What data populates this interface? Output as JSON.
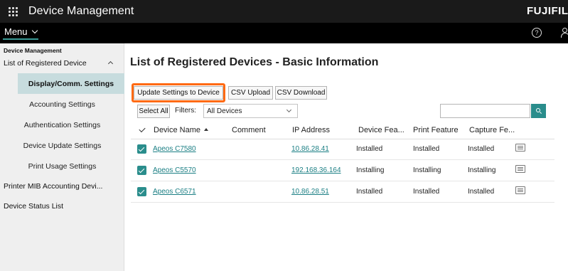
{
  "app": {
    "title": "Device Management",
    "brand": "FUJIFILM",
    "menu_label": "Menu",
    "help_symbol": "?"
  },
  "sidebar": {
    "header": "Device Management",
    "group": "List of Registered Device",
    "subitems": [
      {
        "label": "Display/Comm. Settings",
        "active": true
      },
      {
        "label": "Accounting Settings"
      },
      {
        "label": "Authentication Settings"
      },
      {
        "label": "Device Update Settings"
      },
      {
        "label": "Print Usage Settings"
      }
    ],
    "items": [
      {
        "label": "Printer MIB Accounting Devi..."
      },
      {
        "label": "Device Status List"
      }
    ]
  },
  "main": {
    "title": "List of Registered Devices - Basic Information",
    "toolbar": {
      "update_label": "Update Settings to Device",
      "csv_upload_label": "CSV Upload",
      "csv_download_label": "CSV Download",
      "select_all_label": "Select All",
      "filter_label": "Filters:",
      "filter_value": "All Devices"
    },
    "table": {
      "headers": {
        "device_name": "Device Name",
        "comment": "Comment",
        "ip": "IP Address",
        "device_feature": "Device Fea...",
        "print_feature": "Print Feature",
        "capture_feature": "Capture Fe..."
      },
      "rows": [
        {
          "name": "Apeos C7580",
          "comment": "",
          "ip": "10.86.28.41",
          "device": "Installed",
          "print": "Installed",
          "capture": "Installed"
        },
        {
          "name": "Apeos C5570",
          "comment": "",
          "ip": "192.168.36.164",
          "device": "Installing",
          "print": "Installing",
          "capture": "Installing"
        },
        {
          "name": "Apeos C6571",
          "comment": "",
          "ip": "10.86.28.51",
          "device": "Installed",
          "print": "Installed",
          "capture": "Installed"
        }
      ]
    }
  },
  "colors": {
    "accent": "#2a8d8c",
    "highlight": "#ff6a13",
    "active_nav": "#c7dcde"
  }
}
